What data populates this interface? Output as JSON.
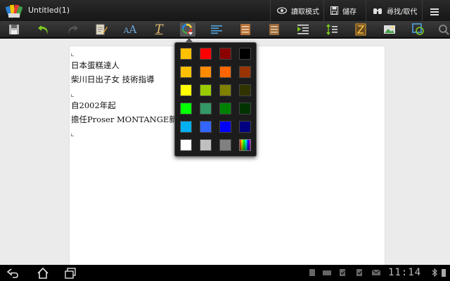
{
  "app": {
    "title": "Untitled(1)"
  },
  "header_actions": [
    {
      "label": "讀取模式",
      "icon": "eye-icon"
    },
    {
      "label": "儲存",
      "icon": "save-icon"
    },
    {
      "label": "尋找/取代",
      "icon": "binoculars-icon"
    }
  ],
  "menu_icon": "menu-icon",
  "toolbar": {
    "tools": [
      "save-icon",
      "undo-icon",
      "redo-icon",
      "edit-note-icon",
      "font-size-icon",
      "font-style-icon",
      "font-color-icon",
      "align-icon",
      "bullet-list-icon",
      "numbered-list-icon",
      "indent-icon",
      "line-spacing-icon",
      "page-break-icon",
      "insert-image-icon",
      "insert-shape-icon",
      "search-icon"
    ]
  },
  "document": {
    "lines": [
      "日本蛋糕達人",
      "柴川日出子女 技術指導",
      "",
      "自2002年起",
      "擔任Proser MONTANGE新人獎大賽評審"
    ]
  },
  "color_popup": {
    "swatches": [
      [
        "#ffc000",
        "#ff0000",
        "#8b0000",
        "#000000"
      ],
      [
        "#ffc000",
        "#ff8c00",
        "#ff6600",
        "#993300"
      ],
      [
        "#ffff00",
        "#99cc00",
        "#808000",
        "#333300"
      ],
      [
        "#00ff00",
        "#339966",
        "#008000",
        "#003300"
      ],
      [
        "#00b0f0",
        "#3366ff",
        "#0000ff",
        "#000080"
      ],
      [
        "#ffffff",
        "#c0c0c0",
        "#808080",
        "spectrum"
      ]
    ],
    "more_colors_icon": "color-spectrum-icon"
  },
  "navbar": {
    "clock": "11:14",
    "buttons": [
      "back-icon",
      "home-icon",
      "recent-apps-icon"
    ]
  }
}
